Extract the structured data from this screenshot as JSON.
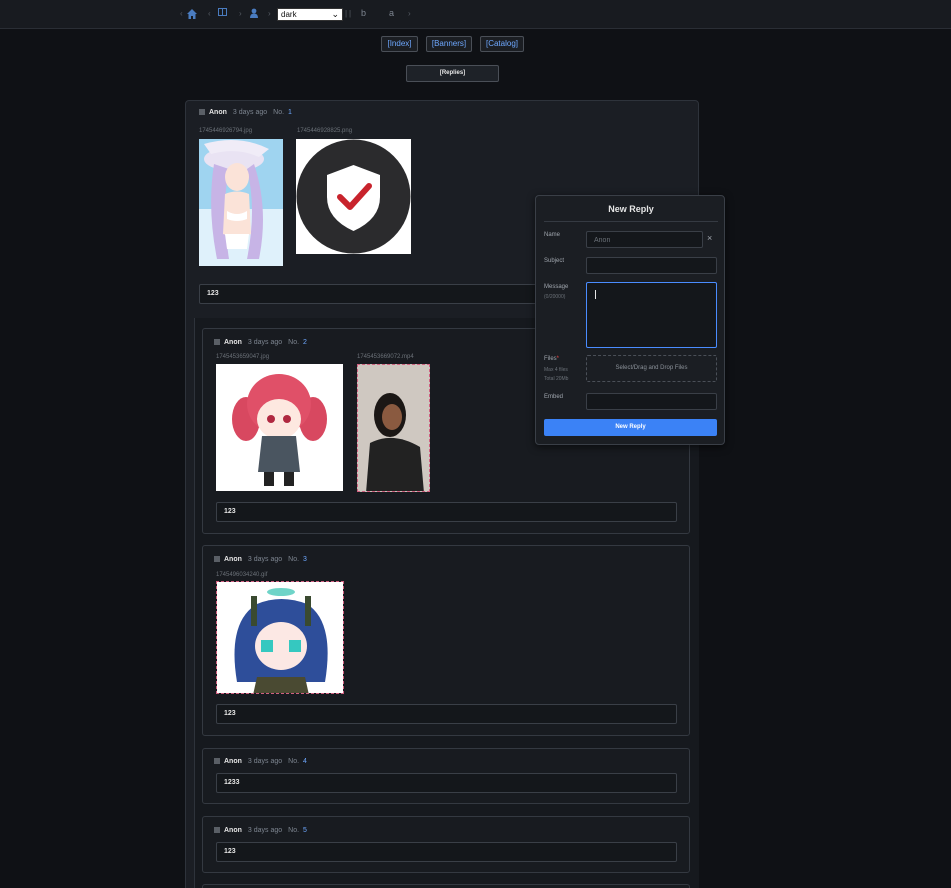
{
  "topbar": {
    "theme_value": "dark",
    "theme_caret": "⌄",
    "icon_b": "b",
    "icon_a": "a",
    "separators": [
      "‹",
      "‹",
      "›",
      "›",
      "|",
      "|",
      "›"
    ]
  },
  "nav": {
    "index": "[Index]",
    "banners": "[Banners]",
    "catalog": "[Catalog]",
    "replies": "[Replies]"
  },
  "op": {
    "name": "Anon",
    "time": "3 days ago",
    "no_label": "No.",
    "no": "1",
    "files": [
      "1745446926794.jpg",
      "1745446928825.png"
    ],
    "message": "123"
  },
  "replies": [
    {
      "name": "Anon",
      "time": "3 days ago",
      "no_label": "No.",
      "no": "2",
      "files": [
        "1745453659047.jpg",
        "1745453669072.mp4"
      ],
      "message": "123"
    },
    {
      "name": "Anon",
      "time": "3 days ago",
      "no_label": "No.",
      "no": "3",
      "files": [
        "1745496034240.gif"
      ],
      "message": "123"
    },
    {
      "name": "Anon",
      "time": "3 days ago",
      "no_label": "No.",
      "no": "4",
      "files": [],
      "message": "1233"
    },
    {
      "name": "Anon",
      "time": "3 days ago",
      "no_label": "No.",
      "no": "5",
      "files": [],
      "message": "123"
    }
  ],
  "modal": {
    "title": "New Reply",
    "name_label": "Name",
    "name_placeholder": "Anon",
    "close": "×",
    "subject_label": "Subject",
    "message_label": "Message",
    "message_counter": "(0/20000)",
    "files_label": "Files",
    "files_required": "*",
    "files_max": "Max 4 files",
    "files_total": "Total 20Mb",
    "drop_text": "Select/Drag and Drop Files",
    "embed_label": "Embed",
    "submit": "New Reply"
  },
  "colors": {
    "accent": "#3b82f6",
    "link": "#6ea8ff",
    "background": "#0f1115"
  }
}
